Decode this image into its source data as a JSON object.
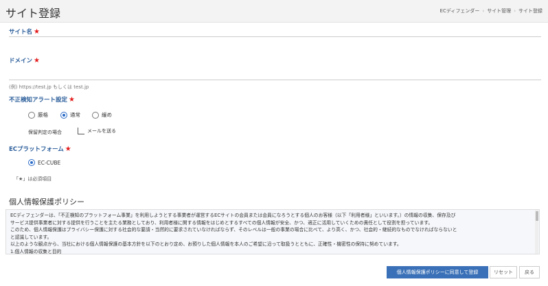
{
  "header": {
    "title": "サイト登録",
    "breadcrumb": [
      "ECディフェンダー",
      "サイト管理",
      "サイト登録"
    ]
  },
  "form": {
    "site_name": {
      "label": "サイト名",
      "value": ""
    },
    "domain": {
      "label": "ドメイン",
      "value": "",
      "hint": "(例) https://test.jp もしくは test.jp"
    },
    "fraud_alert": {
      "label": "不正検知アラート設定",
      "options": [
        "厳格",
        "通常",
        "緩め"
      ],
      "selected": "通常",
      "on_hold_label": "保留判定の場合",
      "checkbox_label": "メールを送る"
    },
    "ec_platform": {
      "label": "ECプラットフォーム",
      "options": [
        "EC-CUBE"
      ],
      "selected": "EC-CUBE"
    },
    "required_note": "「★」は必須項目"
  },
  "policy": {
    "title": "個人情報保護ポリシー",
    "lines": [
      "ECディフェンダーは、「不正検知のプラットフォーム事業」を利用しようとする事業者が運営するECサイトの会員または会員になろうとする個人のお客様（以下「利用者様」といいます。）の情報の収集、保存及び",
      "サービス提供事業者に対する提供を行うことを主たる業務としており、利用者様に関する情報をはじめとするすべての個人情報が安全、かつ、適正に活用していくための責任として役割を担っています。",
      "このため、個人情報保護はプライバシー保護に対する社会的な要請・当然的に要求されていなければならず、そのレベルは一般の事業の場合に比べて、より高く、かつ、社会的・継続的なものでなければならないと",
      "と認識しています。",
      "以上のような観点から、当社における個人情報保護の基本方針を以下のとおり定め、お預りした個人情報を本人のご希望に沿って取扱うとともに、正確性・機密性の保持に努めています。",
      "1.個人情報の収集と目的"
    ]
  },
  "buttons": {
    "agree_register": "個人情報保護ポリシーに同意して登録",
    "reset": "リセット",
    "back": "戻る"
  },
  "colors": {
    "label": "#2a5d9a",
    "required": "#e31a1a",
    "primary": "#3a70b7"
  }
}
